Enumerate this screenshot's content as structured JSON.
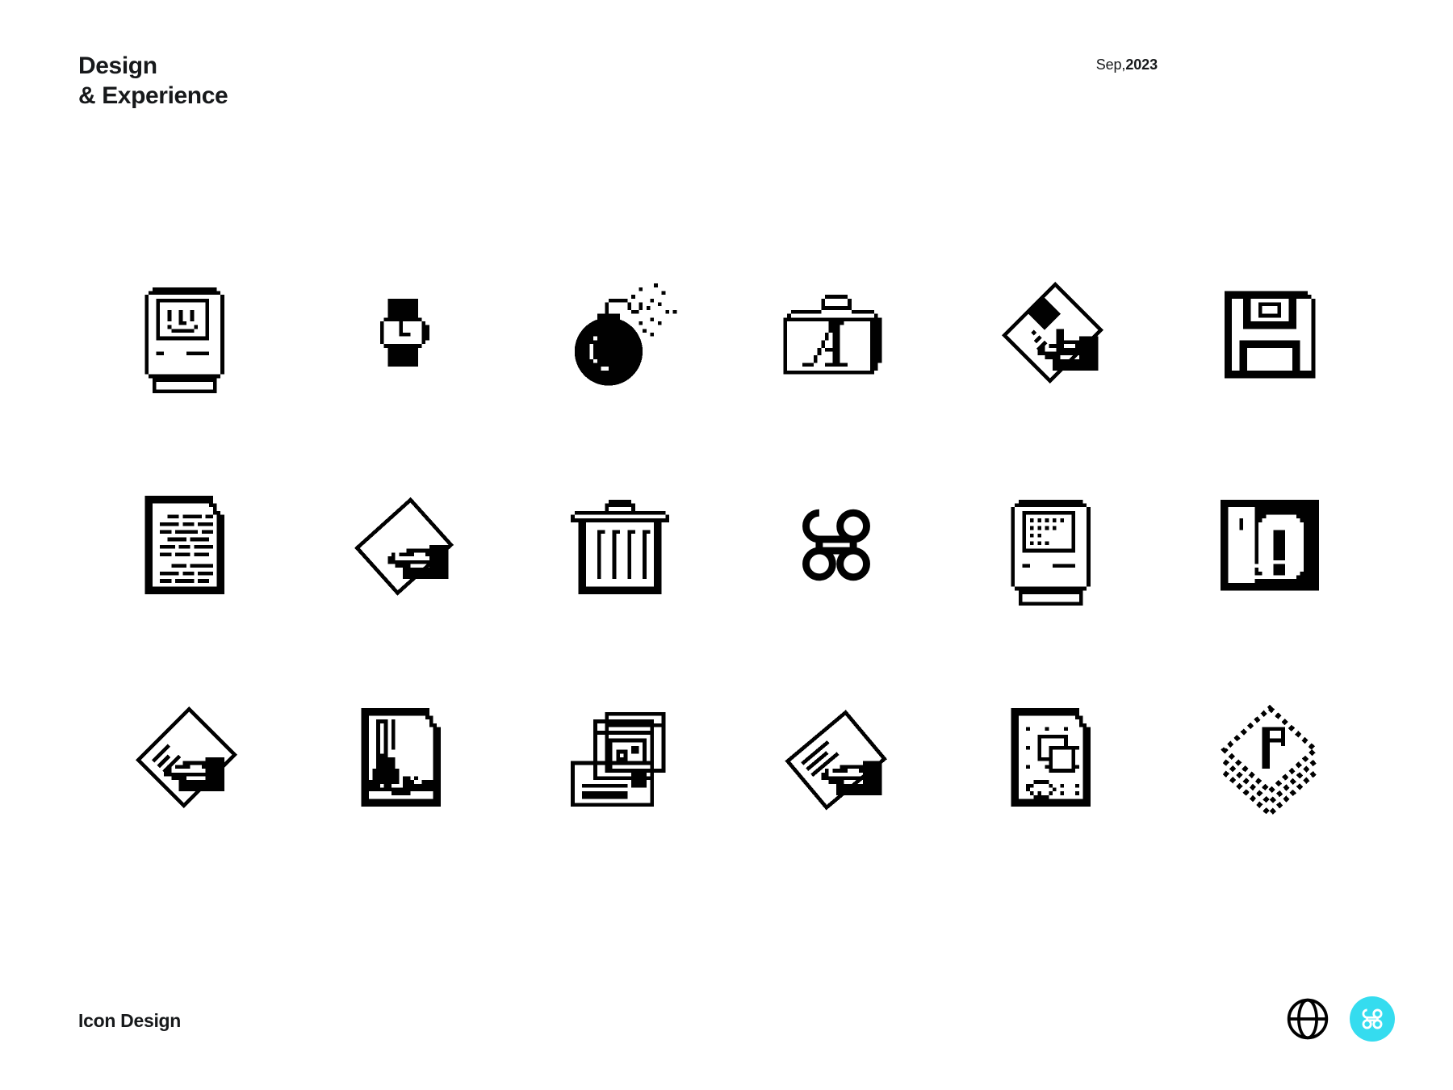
{
  "header": {
    "title": "Design\n& Experience",
    "date_month": "Sep,",
    "date_year": "2023"
  },
  "footer": {
    "label": "Icon Design",
    "icons": [
      {
        "name": "globe-icon",
        "label": "Globe"
      },
      {
        "name": "command-badge-icon",
        "label": "Command",
        "color": "#35DCEF",
        "glyph": "⌘"
      }
    ]
  },
  "grid": {
    "columns": 6,
    "rows": 3,
    "icons": [
      {
        "id": "happy-mac-icon",
        "label": "Happy Mac",
        "row": 1,
        "col": 1
      },
      {
        "id": "wristwatch-wait-icon",
        "label": "Wristwatch Wait",
        "row": 1,
        "col": 2
      },
      {
        "id": "bomb-error-icon",
        "label": "Bomb Error",
        "row": 1,
        "col": 3
      },
      {
        "id": "font-suitcase-icon",
        "label": "Font Suitcase",
        "row": 1,
        "col": 4
      },
      {
        "id": "write-hand-doc-icon",
        "label": "Writing Hand Document",
        "row": 1,
        "col": 5
      },
      {
        "id": "floppy-disk-icon",
        "label": "Floppy Disk",
        "row": 1,
        "col": 6
      },
      {
        "id": "text-document-icon",
        "label": "Text Document",
        "row": 2,
        "col": 1
      },
      {
        "id": "sign-hand-doc-icon",
        "label": "Signing Hand Document",
        "row": 2,
        "col": 2
      },
      {
        "id": "trash-can-icon",
        "label": "Trash Can",
        "row": 2,
        "col": 3
      },
      {
        "id": "command-key-icon",
        "label": "Command Key",
        "row": 2,
        "col": 4
      },
      {
        "id": "disk-needed-mac-icon",
        "label": "Disk Needed Mac",
        "row": 2,
        "col": 5
      },
      {
        "id": "alert-exclamation-icon",
        "label": "Alert Exclamation",
        "row": 2,
        "col": 6
      },
      {
        "id": "edit-hand-doc-icon",
        "label": "Editing Hand Document",
        "row": 3,
        "col": 1
      },
      {
        "id": "pen-document-icon",
        "label": "Pen Document",
        "row": 3,
        "col": 2
      },
      {
        "id": "stacked-mail-icon",
        "label": "Stacked Mail Windows",
        "row": 3,
        "col": 3
      },
      {
        "id": "draw-hand-doc-icon",
        "label": "Drawing Hand Document",
        "row": 3,
        "col": 4
      },
      {
        "id": "shapes-document-icon",
        "label": "Shapes Document",
        "row": 3,
        "col": 5
      },
      {
        "id": "layered-type-icon",
        "label": "Layered Type Stack",
        "row": 3,
        "col": 6
      }
    ]
  },
  "theme": {
    "background": "#FFFFFF",
    "ink": "#010101",
    "accent": "#35DCEF"
  }
}
